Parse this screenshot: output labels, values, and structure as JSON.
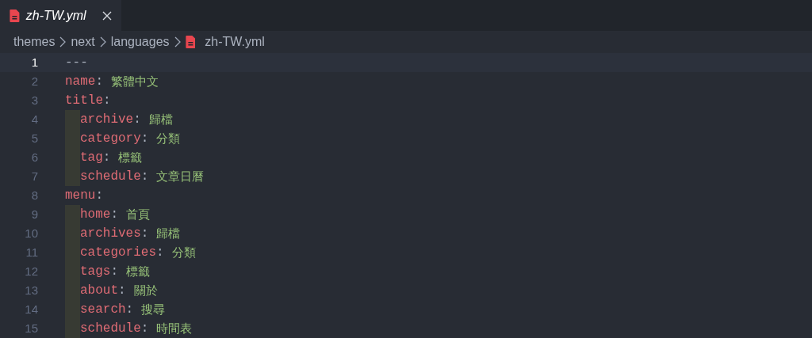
{
  "tabs": [
    {
      "label": "zh-TW.yml",
      "selected": true
    }
  ],
  "breadcrumb": [
    {
      "label": "themes",
      "kind": "folder"
    },
    {
      "label": "next",
      "kind": "folder"
    },
    {
      "label": "languages",
      "kind": "folder"
    },
    {
      "label": "zh-TW.yml",
      "kind": "file"
    }
  ],
  "lines": [
    {
      "number": "1",
      "kind": "marker",
      "text": "---",
      "current": true
    },
    {
      "number": "2",
      "kind": "pair",
      "key": "name",
      "colon": ":",
      "value": "繁體中文",
      "current": false
    },
    {
      "number": "3",
      "kind": "pair",
      "key": "title",
      "colon": ":",
      "current": false,
      "children": [
        {
          "number": "4",
          "kind": "pair",
          "key": "archive",
          "colon": ":",
          "value": "歸檔",
          "current": false
        },
        {
          "number": "5",
          "kind": "pair",
          "key": "category",
          "colon": ":",
          "value": "分類",
          "current": false
        },
        {
          "number": "6",
          "kind": "pair",
          "key": "tag",
          "colon": ":",
          "value": "標籤",
          "current": false
        },
        {
          "number": "7",
          "kind": "pair",
          "key": "schedule",
          "colon": ":",
          "value": "文章日曆",
          "current": false
        }
      ]
    },
    {
      "number": "8",
      "kind": "pair",
      "key": "menu",
      "colon": ":",
      "current": false,
      "children": [
        {
          "number": "9",
          "kind": "pair",
          "key": "home",
          "colon": ":",
          "value": "首頁",
          "current": false
        },
        {
          "number": "10",
          "kind": "pair",
          "key": "archives",
          "colon": ":",
          "value": "歸檔",
          "current": false
        },
        {
          "number": "11",
          "kind": "pair",
          "key": "categories",
          "colon": ":",
          "value": "分類",
          "current": false
        },
        {
          "number": "12",
          "kind": "pair",
          "key": "tags",
          "colon": ":",
          "value": "標籤",
          "current": false
        },
        {
          "number": "13",
          "kind": "pair",
          "key": "about",
          "colon": ":",
          "value": "關於",
          "current": false
        },
        {
          "number": "14",
          "kind": "pair",
          "key": "search",
          "colon": ":",
          "value": "搜尋",
          "current": false
        },
        {
          "number": "15",
          "kind": "pair",
          "key": "schedule",
          "colon": ":",
          "value": "時間表",
          "current": false
        }
      ]
    }
  ]
}
